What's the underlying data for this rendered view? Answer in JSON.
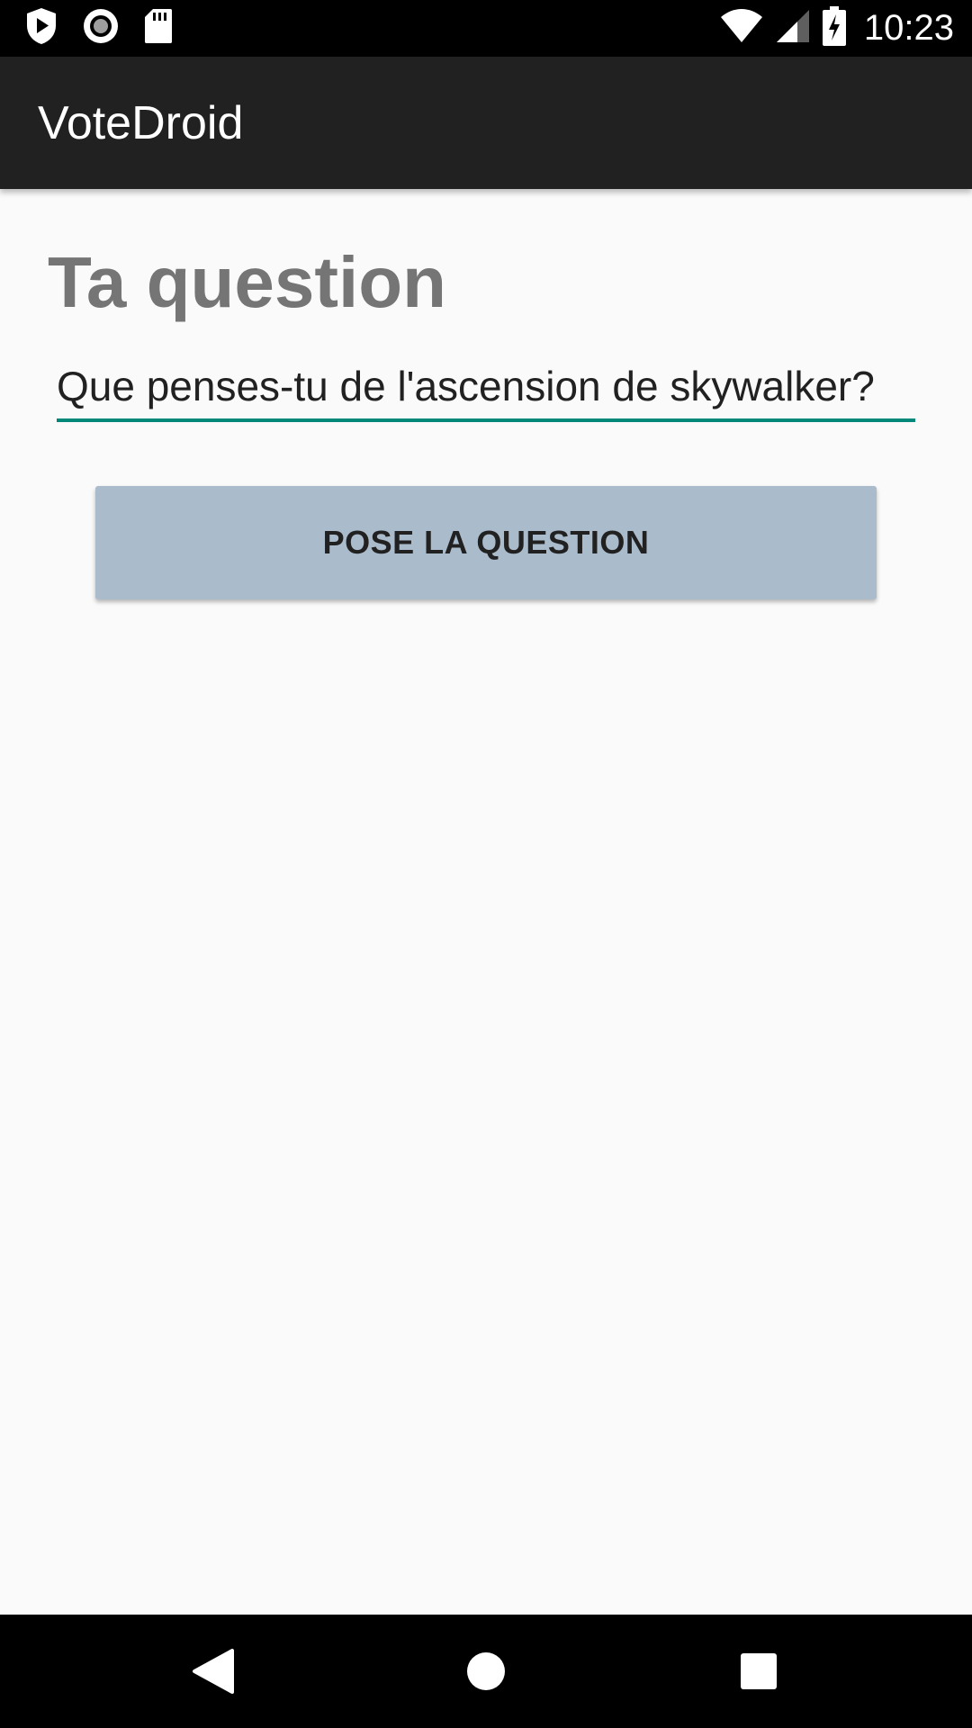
{
  "status_bar": {
    "time": "10:23",
    "icons": [
      "shield-play-icon",
      "record-icon",
      "sd-card-icon",
      "wifi-icon",
      "signal-icon",
      "battery-charging-icon"
    ]
  },
  "app_bar": {
    "title": "VoteDroid"
  },
  "form": {
    "heading": "Ta question",
    "question_value": "Que penses-tu de l'ascension de skywalker?",
    "submit_label": "POSE LA QUESTION"
  },
  "nav_bar": {
    "icons": [
      "back-icon",
      "home-icon",
      "recents-icon"
    ]
  },
  "colors": {
    "app_bar": "#212121",
    "background": "#fafafa",
    "accent": "#00897b",
    "button": "#aabbcc",
    "heading_text": "#757575"
  }
}
